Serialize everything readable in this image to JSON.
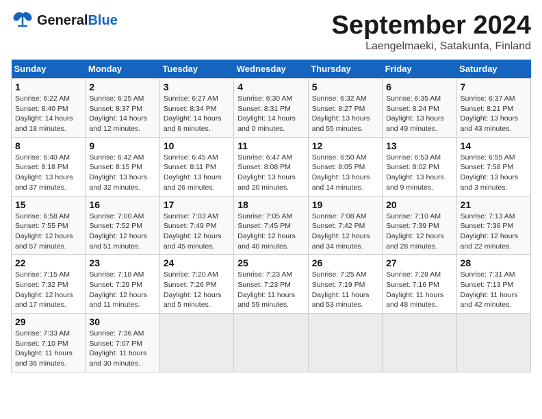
{
  "logo": {
    "general": "General",
    "blue": "Blue"
  },
  "title": "September 2024",
  "subtitle": "Laengelmaeki, Satakunta, Finland",
  "days_header": [
    "Sunday",
    "Monday",
    "Tuesday",
    "Wednesday",
    "Thursday",
    "Friday",
    "Saturday"
  ],
  "weeks": [
    [
      {
        "day": "1",
        "info": "Sunrise: 6:22 AM\nSunset: 8:40 PM\nDaylight: 14 hours\nand 18 minutes."
      },
      {
        "day": "2",
        "info": "Sunrise: 6:25 AM\nSunset: 8:37 PM\nDaylight: 14 hours\nand 12 minutes."
      },
      {
        "day": "3",
        "info": "Sunrise: 6:27 AM\nSunset: 8:34 PM\nDaylight: 14 hours\nand 6 minutes."
      },
      {
        "day": "4",
        "info": "Sunrise: 6:30 AM\nSunset: 8:31 PM\nDaylight: 14 hours\nand 0 minutes."
      },
      {
        "day": "5",
        "info": "Sunrise: 6:32 AM\nSunset: 8:27 PM\nDaylight: 13 hours\nand 55 minutes."
      },
      {
        "day": "6",
        "info": "Sunrise: 6:35 AM\nSunset: 8:24 PM\nDaylight: 13 hours\nand 49 minutes."
      },
      {
        "day": "7",
        "info": "Sunrise: 6:37 AM\nSunset: 8:21 PM\nDaylight: 13 hours\nand 43 minutes."
      }
    ],
    [
      {
        "day": "8",
        "info": "Sunrise: 6:40 AM\nSunset: 8:18 PM\nDaylight: 13 hours\nand 37 minutes."
      },
      {
        "day": "9",
        "info": "Sunrise: 6:42 AM\nSunset: 8:15 PM\nDaylight: 13 hours\nand 32 minutes."
      },
      {
        "day": "10",
        "info": "Sunrise: 6:45 AM\nSunset: 8:11 PM\nDaylight: 13 hours\nand 26 minutes."
      },
      {
        "day": "11",
        "info": "Sunrise: 6:47 AM\nSunset: 8:08 PM\nDaylight: 13 hours\nand 20 minutes."
      },
      {
        "day": "12",
        "info": "Sunrise: 6:50 AM\nSunset: 8:05 PM\nDaylight: 13 hours\nand 14 minutes."
      },
      {
        "day": "13",
        "info": "Sunrise: 6:53 AM\nSunset: 8:02 PM\nDaylight: 13 hours\nand 9 minutes."
      },
      {
        "day": "14",
        "info": "Sunrise: 6:55 AM\nSunset: 7:58 PM\nDaylight: 13 hours\nand 3 minutes."
      }
    ],
    [
      {
        "day": "15",
        "info": "Sunrise: 6:58 AM\nSunset: 7:55 PM\nDaylight: 12 hours\nand 57 minutes."
      },
      {
        "day": "16",
        "info": "Sunrise: 7:00 AM\nSunset: 7:52 PM\nDaylight: 12 hours\nand 51 minutes."
      },
      {
        "day": "17",
        "info": "Sunrise: 7:03 AM\nSunset: 7:49 PM\nDaylight: 12 hours\nand 45 minutes."
      },
      {
        "day": "18",
        "info": "Sunrise: 7:05 AM\nSunset: 7:45 PM\nDaylight: 12 hours\nand 40 minutes."
      },
      {
        "day": "19",
        "info": "Sunrise: 7:08 AM\nSunset: 7:42 PM\nDaylight: 12 hours\nand 34 minutes."
      },
      {
        "day": "20",
        "info": "Sunrise: 7:10 AM\nSunset: 7:39 PM\nDaylight: 12 hours\nand 28 minutes."
      },
      {
        "day": "21",
        "info": "Sunrise: 7:13 AM\nSunset: 7:36 PM\nDaylight: 12 hours\nand 22 minutes."
      }
    ],
    [
      {
        "day": "22",
        "info": "Sunrise: 7:15 AM\nSunset: 7:32 PM\nDaylight: 12 hours\nand 17 minutes."
      },
      {
        "day": "23",
        "info": "Sunrise: 7:18 AM\nSunset: 7:29 PM\nDaylight: 12 hours\nand 11 minutes."
      },
      {
        "day": "24",
        "info": "Sunrise: 7:20 AM\nSunset: 7:26 PM\nDaylight: 12 hours\nand 5 minutes."
      },
      {
        "day": "25",
        "info": "Sunrise: 7:23 AM\nSunset: 7:23 PM\nDaylight: 11 hours\nand 59 minutes."
      },
      {
        "day": "26",
        "info": "Sunrise: 7:25 AM\nSunset: 7:19 PM\nDaylight: 11 hours\nand 53 minutes."
      },
      {
        "day": "27",
        "info": "Sunrise: 7:28 AM\nSunset: 7:16 PM\nDaylight: 11 hours\nand 48 minutes."
      },
      {
        "day": "28",
        "info": "Sunrise: 7:31 AM\nSunset: 7:13 PM\nDaylight: 11 hours\nand 42 minutes."
      }
    ],
    [
      {
        "day": "29",
        "info": "Sunrise: 7:33 AM\nSunset: 7:10 PM\nDaylight: 11 hours\nand 36 minutes."
      },
      {
        "day": "30",
        "info": "Sunrise: 7:36 AM\nSunset: 7:07 PM\nDaylight: 11 hours\nand 30 minutes."
      },
      {
        "day": "",
        "info": ""
      },
      {
        "day": "",
        "info": ""
      },
      {
        "day": "",
        "info": ""
      },
      {
        "day": "",
        "info": ""
      },
      {
        "day": "",
        "info": ""
      }
    ]
  ]
}
